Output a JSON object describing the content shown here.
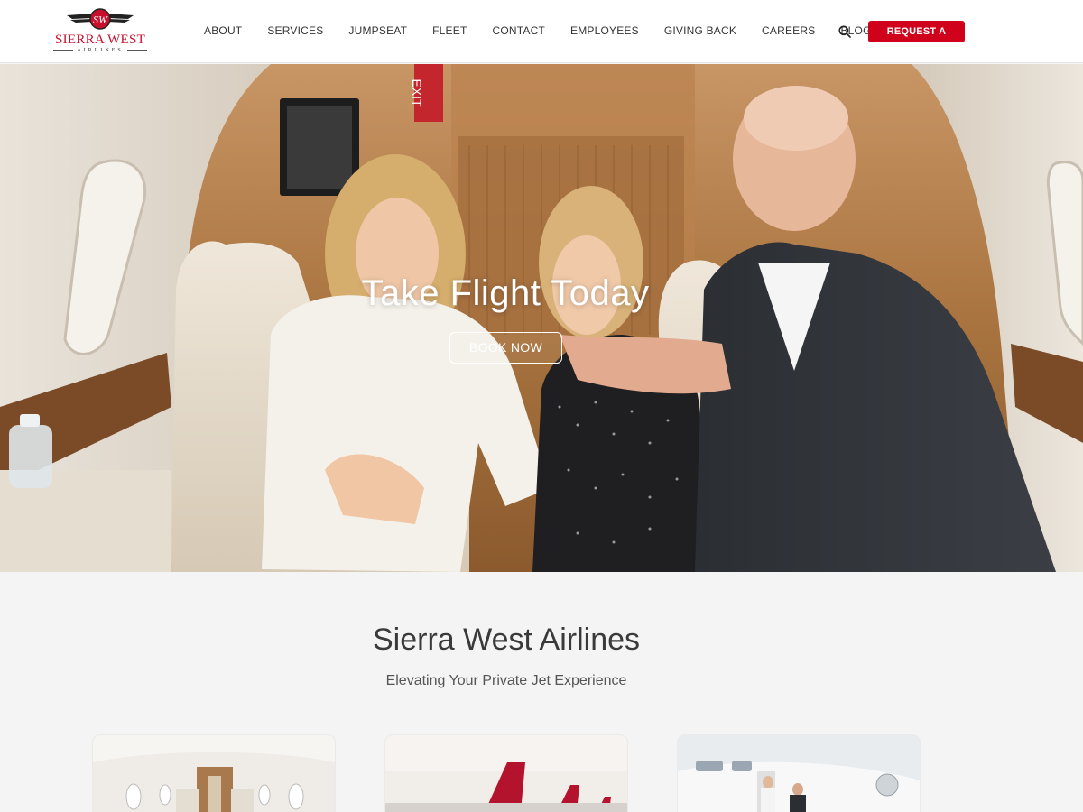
{
  "brand": {
    "name": "SIERRA WEST",
    "subtitle": "AIRLINES",
    "monogram": "SW",
    "accent_color": "#d0021b"
  },
  "nav": {
    "items": [
      "ABOUT",
      "SERVICES",
      "JUMPSEAT",
      "FLEET",
      "CONTACT",
      "EMPLOYEES",
      "GIVING BACK",
      "CAREERS",
      "BLOG"
    ],
    "search_icon": "search-icon",
    "cta_label": "REQUEST A QUOTE"
  },
  "hero": {
    "title": "Take Flight Today",
    "button_label": "BOOK NOW",
    "exit_sign": "EXIT"
  },
  "intro": {
    "title": "Sierra West Airlines",
    "subtitle": "Elevating Your Private Jet Experience"
  }
}
